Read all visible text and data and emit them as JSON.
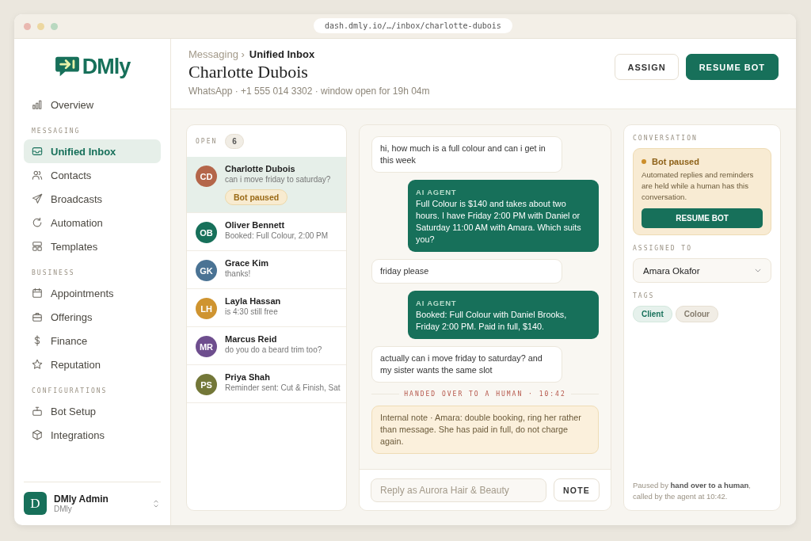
{
  "browser": {
    "address": "dash.dmly.io/…/inbox/charlotte-dubois"
  },
  "sidebar": {
    "logo": "DMly",
    "sections": [
      {
        "items": [
          {
            "label": "Overview",
            "selected": false
          }
        ]
      },
      {
        "heading": "MESSAGING",
        "items": [
          {
            "label": "Unified Inbox",
            "selected": true
          },
          {
            "label": "Contacts",
            "selected": false
          },
          {
            "label": "Broadcasts",
            "selected": false
          },
          {
            "label": "Automation",
            "selected": false
          },
          {
            "label": "Templates",
            "selected": false
          }
        ]
      },
      {
        "heading": "BUSINESS",
        "items": [
          {
            "label": "Appointments",
            "selected": false
          },
          {
            "label": "Offerings",
            "selected": false
          },
          {
            "label": "Finance",
            "selected": false
          },
          {
            "label": "Reputation",
            "selected": false
          }
        ]
      },
      {
        "heading": "CONFIGURATIONS",
        "items": [
          {
            "label": "Bot Setup",
            "selected": false
          },
          {
            "label": "Integrations",
            "selected": false
          }
        ]
      }
    ],
    "user": {
      "initial": "D",
      "name": "DMly Admin",
      "org": "DMly"
    }
  },
  "header": {
    "breadcrumb_parent": "Messaging ›",
    "breadcrumb_current": "Unified Inbox",
    "title": "Charlotte Dubois",
    "subtitle": "WhatsApp · +1 555 014 3302 · window open for 19h 04m",
    "buttons": [
      {
        "label": "ASSIGN",
        "kind": "secondary"
      },
      {
        "label": "RESUME BOT",
        "kind": "primary"
      }
    ]
  },
  "conversations": {
    "heading": "OPEN",
    "count": "6",
    "items": [
      {
        "initials": "CD",
        "name": "Charlotte Dubois",
        "preview": "can i move friday to saturday?",
        "badge": "Bot paused",
        "color": "#b4664a",
        "selected": true
      },
      {
        "initials": "OB",
        "name": "Oliver Bennett",
        "preview": "Booked: Full Colour, 2:00 PM",
        "color": "#17705a",
        "selected": false
      },
      {
        "initials": "GK",
        "name": "Grace Kim",
        "preview": "thanks!",
        "color": "#4a7394",
        "selected": false
      },
      {
        "initials": "LH",
        "name": "Layla Hassan",
        "preview": "is 4:30 still free",
        "color": "#cf9430",
        "selected": false
      },
      {
        "initials": "MR",
        "name": "Marcus Reid",
        "preview": "do you do a beard trim too?",
        "color": "#6e4e8e",
        "selected": false
      },
      {
        "initials": "PS",
        "name": "Priya Shah",
        "preview": "Reminder sent: Cut & Finish, Sat",
        "color": "#737738",
        "selected": false
      }
    ]
  },
  "chat": {
    "messages": [
      {
        "kind": "customer",
        "text": "hi, how much is a full colour and can i get in this week"
      },
      {
        "kind": "agent",
        "sender": "AI AGENT",
        "text": "Full Colour is $140 and takes about two hours. I have Friday 2:00 PM with Daniel or Saturday 11:00 AM with Amara. Which suits you?"
      },
      {
        "kind": "customer",
        "text": "friday please"
      },
      {
        "kind": "agent",
        "sender": "AI AGENT",
        "text": "Booked: Full Colour with Daniel Brooks, Friday 2:00 PM. Paid in full, $140."
      },
      {
        "kind": "customer",
        "text": "actually can i move friday to saturday? and my sister wants the same slot"
      },
      {
        "kind": "divider",
        "text": "HANDED OVER TO A HUMAN · 10:42"
      },
      {
        "kind": "note",
        "text": "Internal note · Amara: double booking, ring her rather than message. She has paid in full, do not charge again."
      }
    ],
    "reply": {
      "placeholder": "Reply as Aurora Hair & Beauty"
    },
    "note_button": "NOTE"
  },
  "details": {
    "heading": "CONVERSATION",
    "status": {
      "title": "Bot paused",
      "text": "Automated replies and reminders are held while a human has this conversation.",
      "button": "RESUME BOT"
    },
    "assigned_label": "ASSIGNED TO",
    "assigned": "Amara Okafor",
    "tags_label": "TAGS",
    "tags": [
      {
        "label": "Client",
        "kind": "primary"
      },
      {
        "label": "Colour",
        "kind": "neutral"
      }
    ],
    "footer": "Paused by **hand over to a human**, called by the agent at 10:42."
  }
}
